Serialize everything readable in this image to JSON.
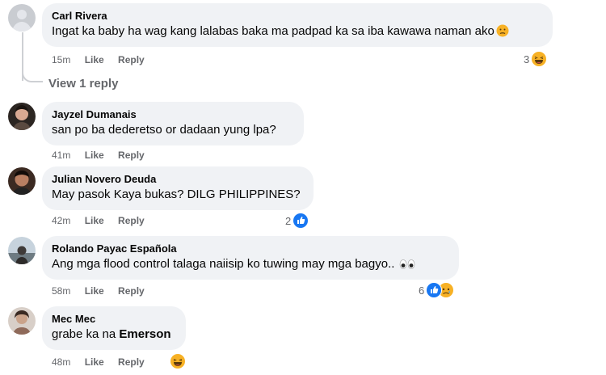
{
  "comments": [
    {
      "author": "Carl Rivera",
      "text": "Ingat ka baby ha wag kang lalabas baka ma padpad ka sa iba kawawa naman ako",
      "time": "15m",
      "like": "Like",
      "reply": "Reply",
      "reaction_count": "3",
      "reactions": [
        "haha-icon"
      ],
      "inline_emoji": "confused-face-icon",
      "view_replies": "View 1 reply"
    },
    {
      "author": "Jayzel Dumanais",
      "text": "san po ba dederetso or dadaan yung lpa?",
      "time": "41m",
      "like": "Like",
      "reply": "Reply"
    },
    {
      "author": "Julian Novero Deuda",
      "text": "May pasok Kaya bukas? DILG PHILIPPINES?",
      "time": "42m",
      "like": "Like",
      "reply": "Reply",
      "reaction_count": "2",
      "reactions": [
        "like-icon"
      ]
    },
    {
      "author": "Rolando Payac Española",
      "text": "Ang mga flood control talaga naiisip ko tuwing may mga bagyo..",
      "time": "58m",
      "like": "Like",
      "reply": "Reply",
      "reaction_count": "6",
      "reactions": [
        "like-icon",
        "sad-icon"
      ],
      "inline_emoji": "eyes-icon"
    },
    {
      "author": "Mec Mec",
      "text_prefix": "grabe ka na ",
      "text_mention": "Emerson",
      "time": "48m",
      "like": "Like",
      "reply": "Reply",
      "reactions": [
        "haha-icon"
      ]
    }
  ],
  "colors": {
    "bubble": "#f0f2f5",
    "meta_text": "#65676b",
    "like_blue": "#1877f2",
    "emoji_yellow": "#f7b125"
  }
}
